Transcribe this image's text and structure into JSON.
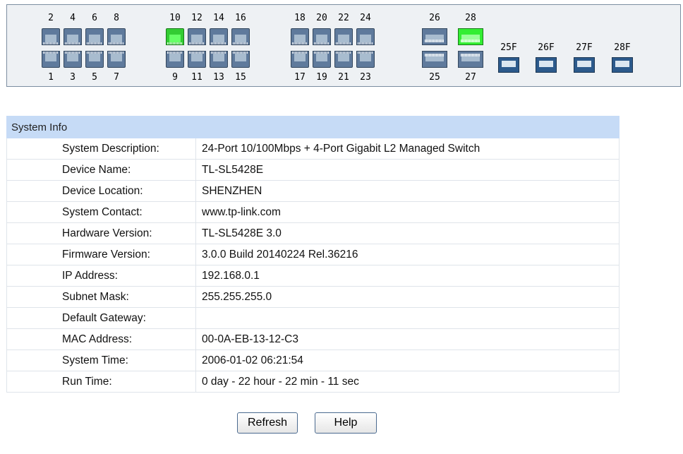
{
  "panel": {
    "top_numbers": [
      "2",
      "4",
      "6",
      "8",
      "10",
      "12",
      "14",
      "16",
      "18",
      "20",
      "22",
      "24"
    ],
    "bottom_numbers": [
      "1",
      "3",
      "5",
      "7",
      "9",
      "11",
      "13",
      "15",
      "17",
      "19",
      "21",
      "23"
    ],
    "active_ports": [
      "10"
    ],
    "gig_top_numbers": [
      "26",
      "28"
    ],
    "gig_bottom_numbers": [
      "25",
      "27"
    ],
    "gig_active": [
      "28"
    ],
    "sfp_labels": [
      "25F",
      "26F",
      "27F",
      "28F"
    ],
    "colors": {
      "active": "#33cc33",
      "port": "#5f7a9c",
      "sfp": "#2c5a8c"
    }
  },
  "system_info": {
    "header": "System Info",
    "rows": [
      {
        "label": "System Description:",
        "value": "24-Port 10/100Mbps + 4-Port Gigabit L2 Managed Switch"
      },
      {
        "label": "Device Name:",
        "value": "TL-SL5428E"
      },
      {
        "label": "Device Location:",
        "value": "SHENZHEN"
      },
      {
        "label": "System Contact:",
        "value": "www.tp-link.com"
      },
      {
        "label": "Hardware Version:",
        "value": "TL-SL5428E 3.0"
      },
      {
        "label": "Firmware Version:",
        "value": "3.0.0 Build 20140224 Rel.36216"
      },
      {
        "label": "IP Address:",
        "value": "192.168.0.1"
      },
      {
        "label": "Subnet Mask:",
        "value": "255.255.255.0"
      },
      {
        "label": "Default Gateway:",
        "value": ""
      },
      {
        "label": "MAC Address:",
        "value": "00-0A-EB-13-12-C3"
      },
      {
        "label": "System Time:",
        "value": "2006-01-02 06:21:54"
      },
      {
        "label": "Run Time:",
        "value": "0 day - 22 hour - 22 min - 11 sec"
      }
    ]
  },
  "buttons": {
    "refresh": "Refresh",
    "help": "Help"
  }
}
